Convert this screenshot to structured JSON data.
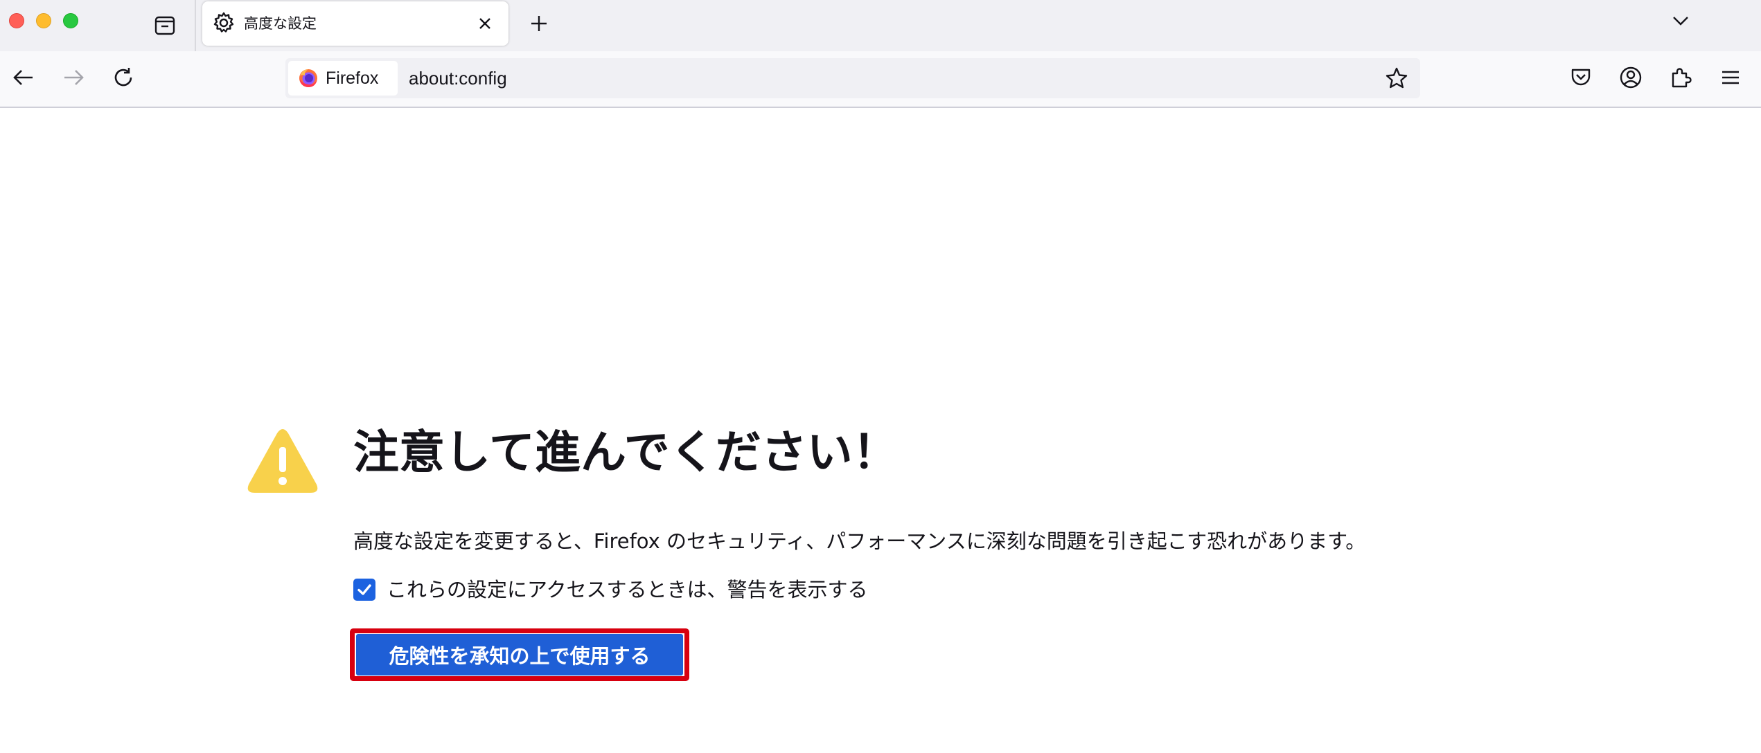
{
  "tab": {
    "title": "高度な設定"
  },
  "urlbar": {
    "identity_label": "Firefox",
    "url": "about:config"
  },
  "content": {
    "title": "注意して進んでください！",
    "description": "高度な設定を変更すると、Firefox のセキュリティ、パフォーマンスに深刻な問題を引き起こす恐れがあります。",
    "checkbox_label": "これらの設定にアクセスするときは、警告を表示する",
    "checkbox_checked": true,
    "accept_button": "危険性を承知の上で使用する"
  },
  "colors": {
    "accent": "#1f5fd6",
    "highlight_border": "#d7000f",
    "warning": "#f8d14b",
    "tabstrip_bg": "#f0f0f4"
  },
  "icons": {
    "tab": "gear-icon",
    "identity": "firefox-logo",
    "warning": "warning-icon"
  }
}
